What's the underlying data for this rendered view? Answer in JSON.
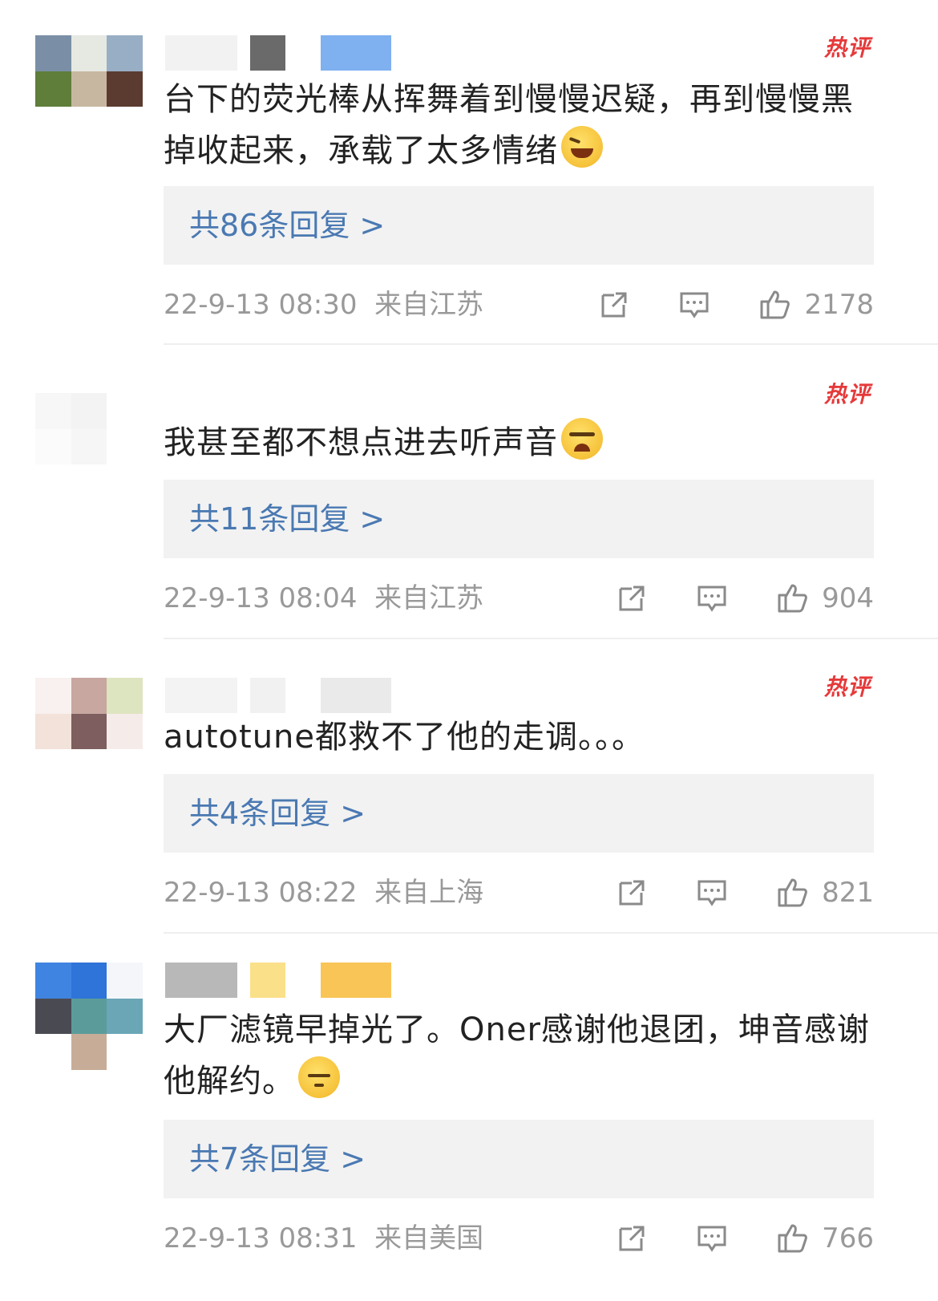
{
  "hot_badge": "热评",
  "comments": [
    {
      "text": "台下的荧光棒从挥舞着到慢慢迟疑，再到慢慢黑掉收起来，承载了太多情绪",
      "emoji": "laughing-tears-emoji",
      "reply_link": "共86条回复 >",
      "timestamp": "22-9-13 08:30",
      "location": "来自江苏",
      "likes": "2178",
      "avatar_colors": [
        "#7a8fa6",
        "#e6e8e2",
        "#98aec4",
        "#5e7e3a",
        "#c7b7a0",
        "#5b3b30",
        "#ffffff",
        "#ffffff",
        "#ffffff"
      ],
      "name_blocks": [
        "#f2f2f2",
        "#6a6a6a",
        "#7fb0f0"
      ]
    },
    {
      "text": "我甚至都不想点进去听声音",
      "emoji": "crying-emoji",
      "reply_link": "共11条回复 >",
      "timestamp": "22-9-13 08:04",
      "location": "来自江苏",
      "likes": "904",
      "avatar_colors": [
        "#f7f7f7",
        "#f3f3f3",
        "#ffffff",
        "#fbfbfb",
        "#f6f6f6",
        "#ffffff",
        "#ffffff",
        "#ffffff",
        "#ffffff"
      ],
      "name_blocks": [
        "#ffffff",
        "#ffffff",
        "#ffffff"
      ]
    },
    {
      "text": "autotune都救不了他的走调。。。",
      "emoji": "",
      "reply_link": "共4条回复 >",
      "timestamp": "22-9-13 08:22",
      "location": "来自上海",
      "likes": "821",
      "avatar_colors": [
        "#f8f1ef",
        "#c7a7a0",
        "#dde4c0",
        "#f2e2d9",
        "#7e5e5e",
        "#f5ecea",
        "#ffffff",
        "#ffffff",
        "#ffffff"
      ],
      "name_blocks": [
        "#f3f3f3",
        "#f1f1f1",
        "#eaeaea"
      ]
    },
    {
      "text": "大厂滤镜早掉光了。Oner感谢他退团，坤音感谢他解约。",
      "emoji": "sweat-emoji",
      "reply_link": "共7条回复 >",
      "timestamp": "22-9-13 08:31",
      "location": "来自美国",
      "likes": "766",
      "avatar_colors": [
        "#3f84e0",
        "#2f74d8",
        "#f4f6f9",
        "#4a4a52",
        "#5b9c9a",
        "#6aa6b6",
        "#ffffff",
        "#c7ad98",
        "#ffffff"
      ],
      "name_blocks": [
        "#b8b8b8",
        "#fbe08a",
        "#f8c556"
      ]
    }
  ]
}
